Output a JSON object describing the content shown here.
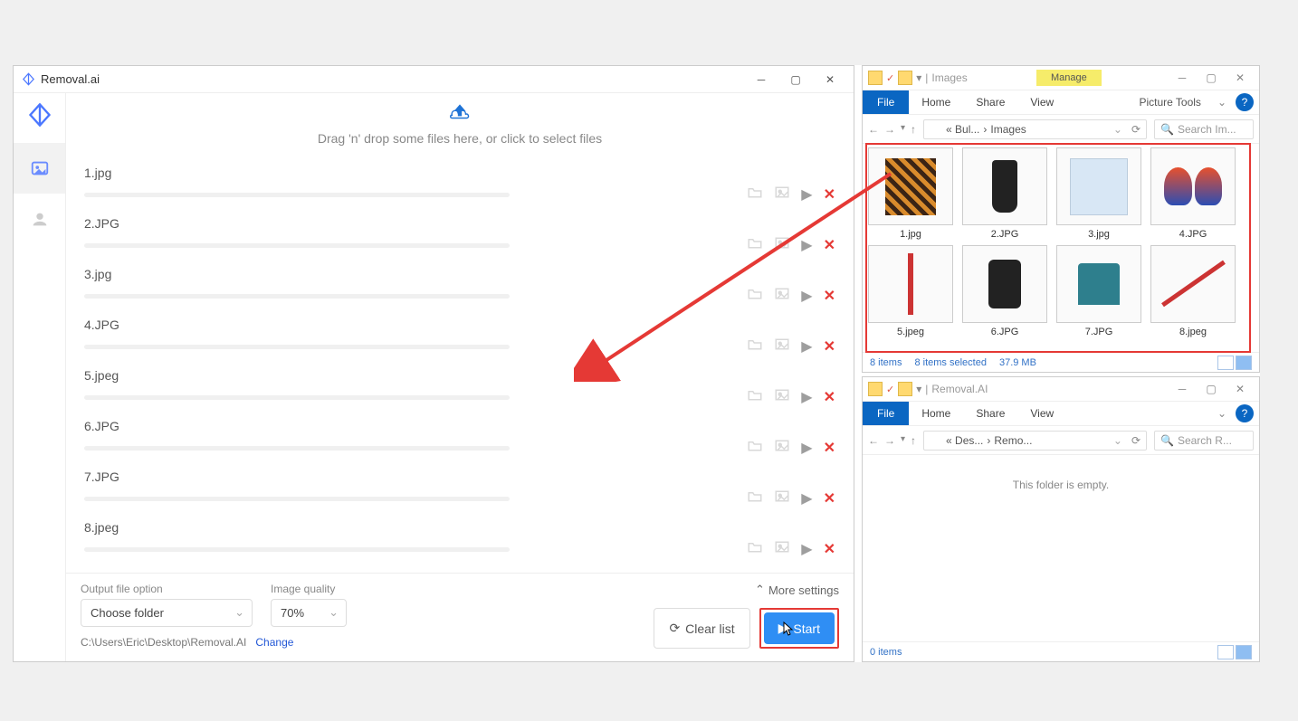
{
  "app": {
    "title": "Removal.ai",
    "dropzone_text": "Drag 'n' drop some files here, or click to select files",
    "files": [
      {
        "name": "1.jpg"
      },
      {
        "name": "2.JPG"
      },
      {
        "name": "3.jpg"
      },
      {
        "name": "4.JPG"
      },
      {
        "name": "5.jpeg"
      },
      {
        "name": "6.JPG"
      },
      {
        "name": "7.JPG"
      },
      {
        "name": "8.jpeg"
      }
    ],
    "footer": {
      "output_label": "Output file option",
      "output_value": "Choose folder",
      "quality_label": "Image quality",
      "quality_value": "70%",
      "path": "C:\\Users\\Eric\\Desktop\\Removal.AI",
      "change": "Change",
      "more": "More settings",
      "clear": "Clear list",
      "start": "Start"
    }
  },
  "explorer_top": {
    "title": "Images",
    "manage": "Manage",
    "tabs": {
      "file": "File",
      "home": "Home",
      "share": "Share",
      "view": "View",
      "pic": "Picture Tools"
    },
    "crumbs": [
      "« Bul...",
      "Images"
    ],
    "search_placeholder": "Search Im...",
    "thumbs": [
      "1.jpg",
      "2.JPG",
      "3.jpg",
      "4.JPG",
      "5.jpeg",
      "6.JPG",
      "7.JPG",
      "8.jpeg"
    ],
    "status": {
      "count": "8 items",
      "selected": "8 items selected",
      "size": "37.9 MB"
    }
  },
  "explorer_bot": {
    "title": "Removal.AI",
    "tabs": {
      "file": "File",
      "home": "Home",
      "share": "Share",
      "view": "View"
    },
    "crumbs": [
      "« Des...",
      "Remo..."
    ],
    "search_placeholder": "Search R...",
    "empty": "This folder is empty.",
    "status": {
      "count": "0 items"
    }
  }
}
